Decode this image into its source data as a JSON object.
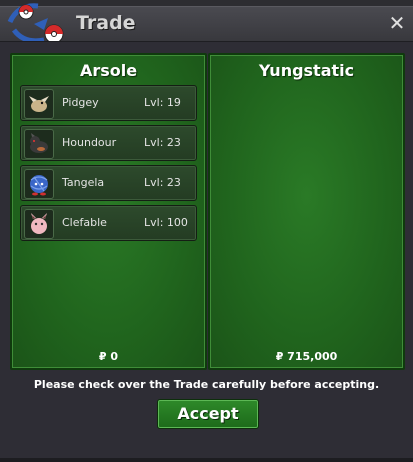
{
  "window": {
    "title": "Trade",
    "close_label": "✕"
  },
  "left_trader": {
    "name": "Arsole",
    "money": "₽ 0",
    "pokemon": [
      {
        "name": "Pidgey",
        "level": "Lvl: 19",
        "icon": "pidgey-icon"
      },
      {
        "name": "Houndour",
        "level": "Lvl: 23",
        "icon": "houndour-icon"
      },
      {
        "name": "Tangela",
        "level": "Lvl: 23",
        "icon": "tangela-icon"
      },
      {
        "name": "Clefable",
        "level": "Lvl: 100",
        "icon": "clefable-icon"
      }
    ]
  },
  "right_trader": {
    "name": "Yungstatic",
    "money": "₽ 715,000",
    "pokemon": []
  },
  "notice": "Please check over the Trade carefully before accepting.",
  "accept_label": "Accept",
  "colors": {
    "panel_green": "#20641d",
    "window_bg": "#2e2d35",
    "accent": "#2e8a2a"
  }
}
